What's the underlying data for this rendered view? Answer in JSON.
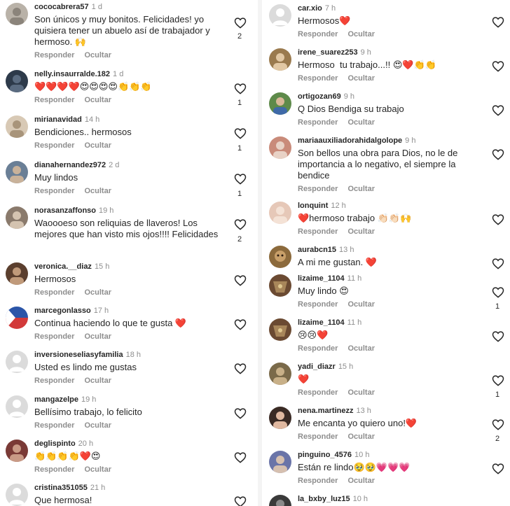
{
  "labels": {
    "reply": "Responder",
    "hide": "Ocultar"
  },
  "colors": {
    "heart_outline": "#262626",
    "muted": "#8e8e8e",
    "text": "#262626"
  },
  "icons": {
    "like": "heart-outline-icon"
  },
  "left": [
    {
      "user": "cococabrera57",
      "time": "1 d",
      "text": "Son únicos y muy bonitos. Felicidades! yo quisiera tener un abuelo así de trabajador y hermoso. 🙌",
      "likes": "2",
      "avatar": "#b9b2a8"
    },
    {
      "user": "nelly.insaurralde.182",
      "time": "1 d",
      "text": "❤️❤️❤️❤️😍😍😍😍👏👏👏",
      "likes": "1",
      "avatar": "#2d3a4a"
    },
    {
      "user": "mirianavidad",
      "time": "14 h",
      "text": "Bendiciones.. hermosos",
      "likes": "1",
      "avatar": "#d8c9b5"
    },
    {
      "user": "dianahernandez972",
      "time": "2 d",
      "text": "Muy lindos",
      "likes": "1",
      "avatar": "#6a7f96"
    },
    {
      "user": "norasanzaffonso",
      "time": "19 h",
      "text": "Waoooeso son reliquias de llaveros! Los mejores que han visto mis ojos!!!! Felicidades",
      "likes": "2",
      "avatar": "#8a7a6c"
    },
    {
      "user": "veronica.__diaz",
      "time": "15 h",
      "text": "Hermosos",
      "likes": "",
      "avatar": "#5b3f2e"
    },
    {
      "user": "marcegonlasso",
      "time": "17 h",
      "text": "Continua haciendo lo que te gusta ❤️",
      "likes": "",
      "avatar": "#2b55a8"
    },
    {
      "user": "inversioneseliasyfamilia",
      "time": "18 h",
      "text": "Usted es lindo me gustas",
      "likes": "",
      "avatar": "default"
    },
    {
      "user": "mangazelpe",
      "time": "19 h",
      "text": "Bellísimo trabajo, lo felicito",
      "likes": "",
      "avatar": "default"
    },
    {
      "user": "deglispinto",
      "time": "20 h",
      "text": "👏👏👏👏❤️😍",
      "likes": "",
      "avatar": "#7a3a36"
    },
    {
      "user": "cristina351055",
      "time": "21 h",
      "text": "Que hermosa!",
      "likes": "",
      "avatar": "default"
    }
  ],
  "right": [
    {
      "user": "car.xio",
      "time": "7 h",
      "text": "Hermosos❤️",
      "likes": "",
      "avatar": "default"
    },
    {
      "user": "irene_suarez253",
      "time": "9 h",
      "text": "Hermoso  tu trabajo...!! 😍❤️👏👏",
      "likes": "",
      "avatar": "#9a7a4e"
    },
    {
      "user": "ortigozan69",
      "time": "9 h",
      "text": "Q Dios Bendiga su trabajo",
      "likes": "",
      "avatar": "#5e8a4a"
    },
    {
      "user": "mariaauxiliadorahidalgolope",
      "time": "9 h",
      "text": "Son bellos una obra para Dios, no le de importancia a lo negativo, el siempre la bendice",
      "likes": "",
      "avatar": "#c98b7a"
    },
    {
      "user": "lonquint",
      "time": "12 h",
      "text": "❤️hermoso trabajo 👏🏻👏🏻🙌",
      "likes": "",
      "avatar": "#e6c8b8"
    },
    {
      "user": "aurabcn15",
      "time": "13 h",
      "text": "A mi me gustan. ❤️",
      "likes": "",
      "avatar": "#8c6a3c"
    },
    {
      "user": "lizaime_1104",
      "time": "11 h",
      "text": "Muy lindo 😍",
      "likes": "1",
      "avatar": "#6b4a32"
    },
    {
      "user": "lizaime_1104",
      "time": "11 h",
      "text": "😢😢❤️",
      "likes": "",
      "avatar": "#6b4a32"
    },
    {
      "user": "yadi_diazr",
      "time": "15 h",
      "text": "❤️",
      "likes": "1",
      "avatar": "#7a6a4a"
    },
    {
      "user": "nena.martinezz",
      "time": "13 h",
      "text": "Me encanta yo quiero uno!❤️",
      "likes": "2",
      "avatar": "#3a2a24"
    },
    {
      "user": "pinguino_4576",
      "time": "10 h",
      "text": "Están re lindo🥹🥹💗💗💗",
      "likes": "",
      "avatar": "#6a74a8"
    },
    {
      "user": "la_bxby_luz15",
      "time": "10 h",
      "text": "",
      "likes": "",
      "avatar": "#3a3a3a"
    }
  ]
}
